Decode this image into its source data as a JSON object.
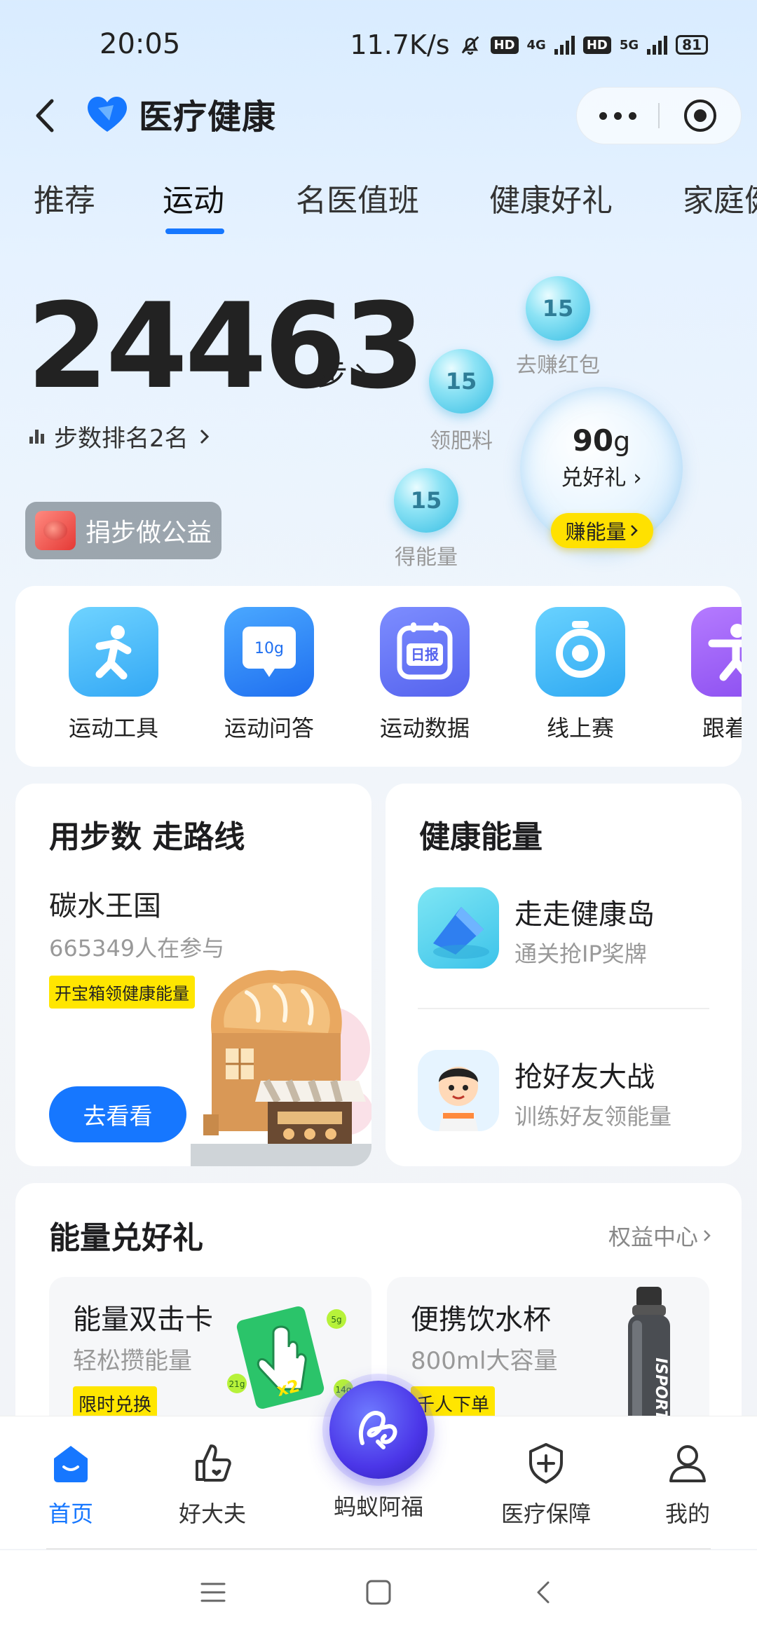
{
  "status_bar": {
    "time": "20:05",
    "net_speed": "11.7K/s",
    "hd1": "HD",
    "net1": "4G",
    "hd2": "HD",
    "net2": "5G",
    "battery": "81"
  },
  "header": {
    "app_name": "医疗健康"
  },
  "tabs": [
    "推荐",
    "运动",
    "名医值班",
    "健康好礼",
    "家庭健"
  ],
  "steps": {
    "count": "24463",
    "unit": "步",
    "rank_text": "步数排名2名"
  },
  "charity": {
    "label": "捐步做公益"
  },
  "energy_bubbles": [
    {
      "value": "15",
      "label": "去赚红包"
    },
    {
      "value": "15",
      "label": "领肥料"
    },
    {
      "value": "15",
      "label": "得能量"
    }
  ],
  "energy_total": {
    "value": "90",
    "unit": "g",
    "action": "兑好礼",
    "earn_button": "赚能量"
  },
  "tools": [
    {
      "label": "运动工具",
      "icon": "running-person-icon",
      "color": "#3fb7f6"
    },
    {
      "label": "运动问答",
      "icon": "10g-chat-icon",
      "color": "#2f86f7",
      "badge": "10g"
    },
    {
      "label": "运动数据",
      "icon": "daily-report-icon",
      "color": "#5f6ff2",
      "badge": "日报"
    },
    {
      "label": "线上赛",
      "icon": "medal-ring-icon",
      "color": "#3cb8f5"
    },
    {
      "label": "跟着练",
      "icon": "stretch-person-icon",
      "color": "#9a5cf0"
    }
  ],
  "route_card": {
    "title": "用步数 走路线",
    "route_name": "碳水王国",
    "participants": "665349人在参与",
    "tag": "开宝箱领健康能量",
    "button": "去看看"
  },
  "energy_card": {
    "title": "健康能量",
    "items": [
      {
        "name": "走走健康岛",
        "desc": "通关抢IP奖牌",
        "icon": "health-island-icon"
      },
      {
        "name": "抢好友大战",
        "desc": "训练好友领能量",
        "icon": "friend-avatar-icon"
      }
    ]
  },
  "gifts": {
    "title": "能量兑好礼",
    "more": "权益中心",
    "items": [
      {
        "name": "能量双击卡",
        "desc": "轻松攒能量",
        "tag": "限时兑换",
        "card_text": "x2",
        "energy_tags": [
          "5g",
          "21g",
          "14g"
        ]
      },
      {
        "name": "便携饮水杯",
        "desc": "800ml大容量",
        "tag": "千人下单",
        "bottle_text": "ISPORT"
      }
    ]
  },
  "bottom_nav": [
    {
      "label": "首页",
      "icon": "home-icon",
      "active": true
    },
    {
      "label": "好大夫",
      "icon": "thumbs-up-heart-icon",
      "active": false
    },
    {
      "label": "蚂蚁阿福",
      "icon": "afu-logo-icon",
      "active": false
    },
    {
      "label": "医疗保障",
      "icon": "medical-shield-icon",
      "active": false
    },
    {
      "label": "我的",
      "icon": "person-icon",
      "active": false
    }
  ],
  "colors": {
    "accent": "#1677ff",
    "tag_yellow": "#ffe600",
    "bubble": "#36bde3"
  }
}
